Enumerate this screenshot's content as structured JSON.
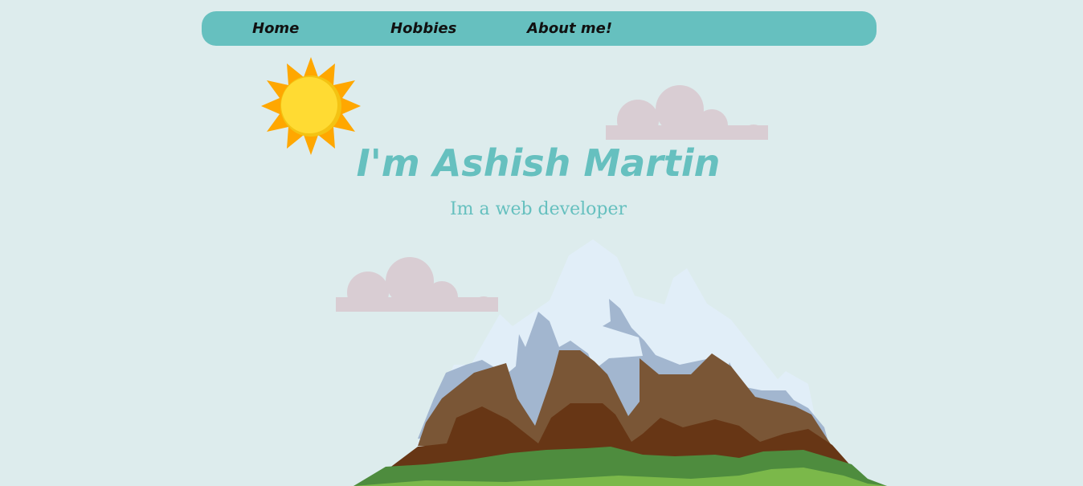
{
  "nav": {
    "items": [
      {
        "label": "Home"
      },
      {
        "label": "Hobbies"
      },
      {
        "label": "About me!"
      }
    ]
  },
  "hero": {
    "title": "I'm Ashish Martin",
    "subtitle": "Im a web developer"
  },
  "decor": {
    "sun_icon": "sun-icon",
    "cloud_icon": "cloud-icon",
    "mountain_icon": "mountain-illustration"
  },
  "colors": {
    "background": "#ddeced",
    "accent": "#66c0bf",
    "nav_text": "#111111",
    "sun_outer": "#ffa700",
    "sun_inner": "#ffdb33",
    "cloud": "#d9cdd3",
    "snow": "#e1eef8",
    "rock_shadow": "#a2b6cf",
    "earth_light": "#7a5636",
    "earth_dark": "#673615",
    "grass_dark": "#4e8c3e",
    "grass_light": "#7bb84a"
  }
}
